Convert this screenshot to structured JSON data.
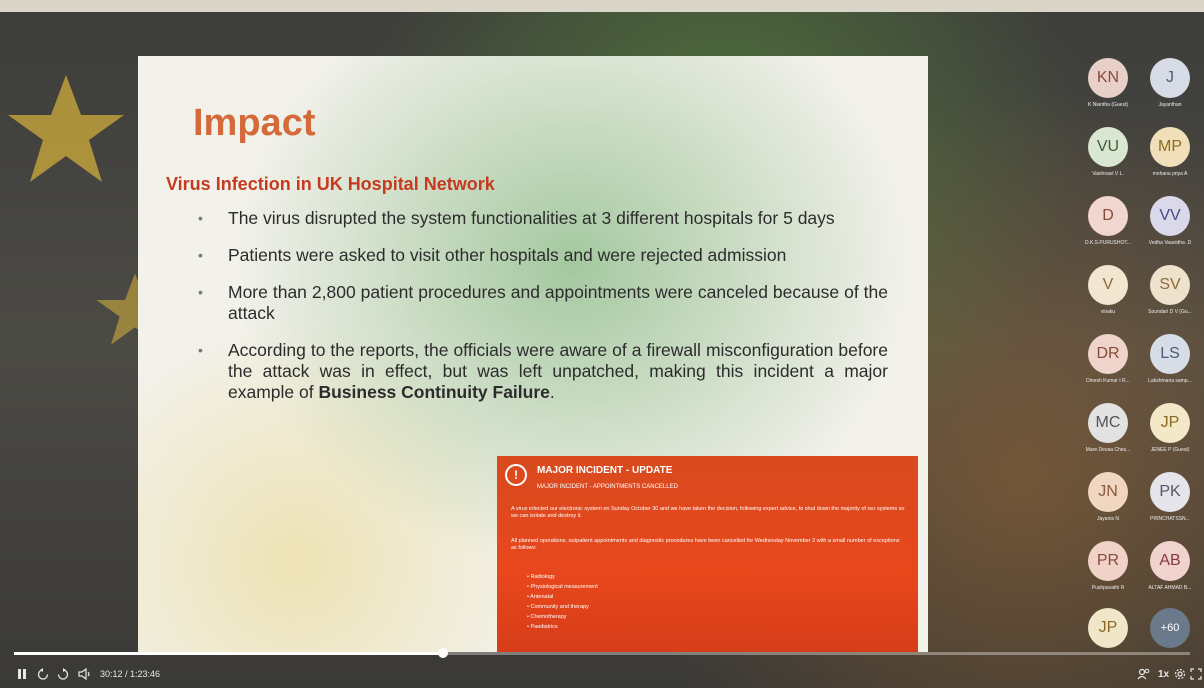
{
  "slide": {
    "title": "Impact",
    "subtitle": "Virus Infection in UK Hospital Network",
    "bullets": [
      {
        "text": "The virus disrupted the system functionalities at 3 different hospitals for 5 days",
        "bold": ""
      },
      {
        "text": "Patients were asked to visit other hospitals and were rejected admission",
        "bold": ""
      },
      {
        "text": "More than 2,800 patient procedures and appointments were canceled because of the attack",
        "bold": ""
      },
      {
        "text": "According to the reports, the officials were aware of a firewall misconfiguration before the attack was in effect, but was left unpatched, making this incident a major example of ",
        "bold": "Business Continuity Failure",
        "tail": "."
      }
    ],
    "incident": {
      "title": "MAJOR INCIDENT - UPDATE",
      "subtitle": "MAJOR INCIDENT - APPOINTMENTS CANCELLED",
      "para1": "A virus infected our electronic system on Sunday October 30 and we have taken the decision, following expert advice, to shut down the majority of our systems so we can isolate and destroy it.",
      "para2": "All planned operations, outpatient appointments and diagnostic procedures have been cancelled for Wednesday November 2 with a small number of exceptions as follows:",
      "list": [
        "Radiology",
        "Physiological measurement",
        "Antenatal",
        "Community and therapy",
        "Chemotherapy",
        "Paediatrics"
      ]
    }
  },
  "participants": [
    {
      "initials": "KN",
      "name": "K Niantha (Guest)",
      "bg": "#e8d0c8",
      "fg": "#8a4a3a"
    },
    {
      "initials": "J",
      "name": "Jayanthan",
      "bg": "#d6dbe6",
      "fg": "#4b5b78"
    },
    {
      "initials": "VU",
      "name": "Vaishnavi V L.",
      "bg": "#d9e6d2",
      "fg": "#3e5e38"
    },
    {
      "initials": "MP",
      "name": "mohana priya A",
      "bg": "#f0dfb8",
      "fg": "#8a6a22"
    },
    {
      "initials": "D",
      "name": "D.K.S.PURUSHOT...",
      "bg": "#f0d6cf",
      "fg": "#8a4a3a"
    },
    {
      "initials": "VV",
      "name": "Vedha Vaavidha .D",
      "bg": "#dad9ec",
      "fg": "#4b4a7e"
    },
    {
      "initials": "V",
      "name": "vivaku",
      "bg": "#f3e6d0",
      "fg": "#8a6a3a"
    },
    {
      "initials": "SV",
      "name": "Soundari D V (Gu...",
      "bg": "#efe2cc",
      "fg": "#8a6a3a"
    },
    {
      "initials": "DR",
      "name": "Dinesh Kumar I R...",
      "bg": "#efd4cc",
      "fg": "#8a4a3a"
    },
    {
      "initials": "LS",
      "name": "Lakshmana samp...",
      "bg": "#d6dde6",
      "fg": "#4b5b78"
    },
    {
      "initials": "MC",
      "name": "Mare Devaa Ches...",
      "bg": "#e2e2e2",
      "fg": "#555555"
    },
    {
      "initials": "JP",
      "name": "JENEE P (Guest)",
      "bg": "#f3e8c8",
      "fg": "#8a6a22"
    },
    {
      "initials": "JN",
      "name": "Jayanis N",
      "bg": "#f0d6c0",
      "fg": "#8a5a3a"
    },
    {
      "initials": "PK",
      "name": "PRINCHATSSN...",
      "bg": "#e4e4ea",
      "fg": "#555566"
    },
    {
      "initials": "PR",
      "name": "Pushpavathi R",
      "bg": "#f0d2c8",
      "fg": "#8a4a3a"
    },
    {
      "initials": "AB",
      "name": "ALTAF AHMAD B...",
      "bg": "#f0d2ce",
      "fg": "#8a3a3a"
    },
    {
      "initials": "JP",
      "name": "",
      "bg": "#f0e6c8",
      "fg": "#8a6a22"
    },
    {
      "initials": "+60",
      "name": "",
      "bg": "#6a7a8a",
      "fg": "#ffffff"
    }
  ],
  "player": {
    "time": "30:12 / 1:23:46",
    "progress": 0.365,
    "speed": "1x",
    "icons": [
      "pause-icon",
      "rewind-icon",
      "forward-icon",
      "volume-icon",
      "participants-icon",
      "settings-icon",
      "fullscreen-icon"
    ]
  }
}
